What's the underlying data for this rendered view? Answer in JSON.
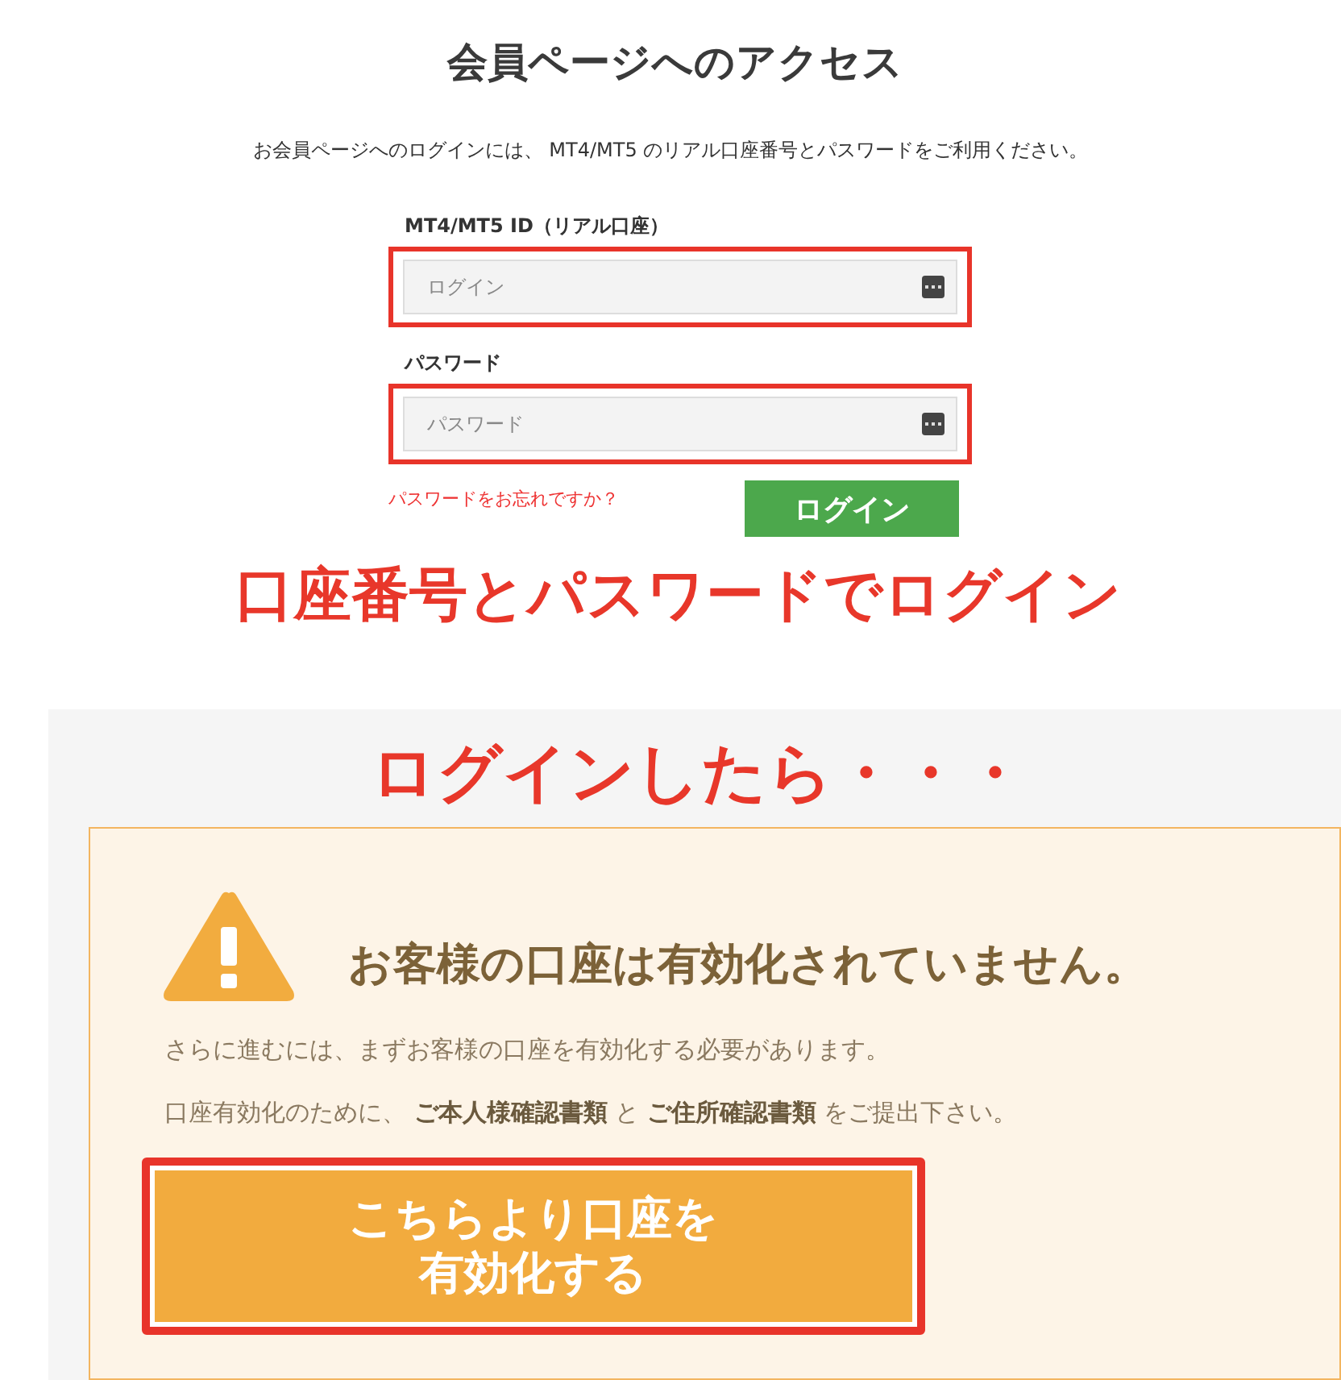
{
  "page": {
    "title": "会員ページへのアクセス",
    "intro": "お会員ページへのログインには、 MT4/MT5 のリアル口座番号とパスワードをご利用ください。"
  },
  "login_form": {
    "fields": [
      {
        "label": "MT4/MT5 ID（リアル口座）",
        "placeholder": "ログイン",
        "highlighted": true
      },
      {
        "label": "パスワード",
        "placeholder": "パスワード",
        "highlighted": true
      }
    ],
    "forgot_link": "パスワードをお忘れですか？",
    "login_button": "ログイン"
  },
  "captions": [
    "口座番号とパスワードでログイン",
    "ログインしたら・・・"
  ],
  "alert": {
    "heading": "お客様の口座は有効化されていません。",
    "lines": [
      "さらに進むには、まずお客様の口座を有効化する必要があります。",
      "口座有効化のために、 **ご本人様確認書類** と **ご住所確認書類** をご提出下さい。"
    ],
    "button": {
      "label_lines": [
        "こちらより口座を",
        "有効化する"
      ],
      "highlighted": true
    }
  }
}
